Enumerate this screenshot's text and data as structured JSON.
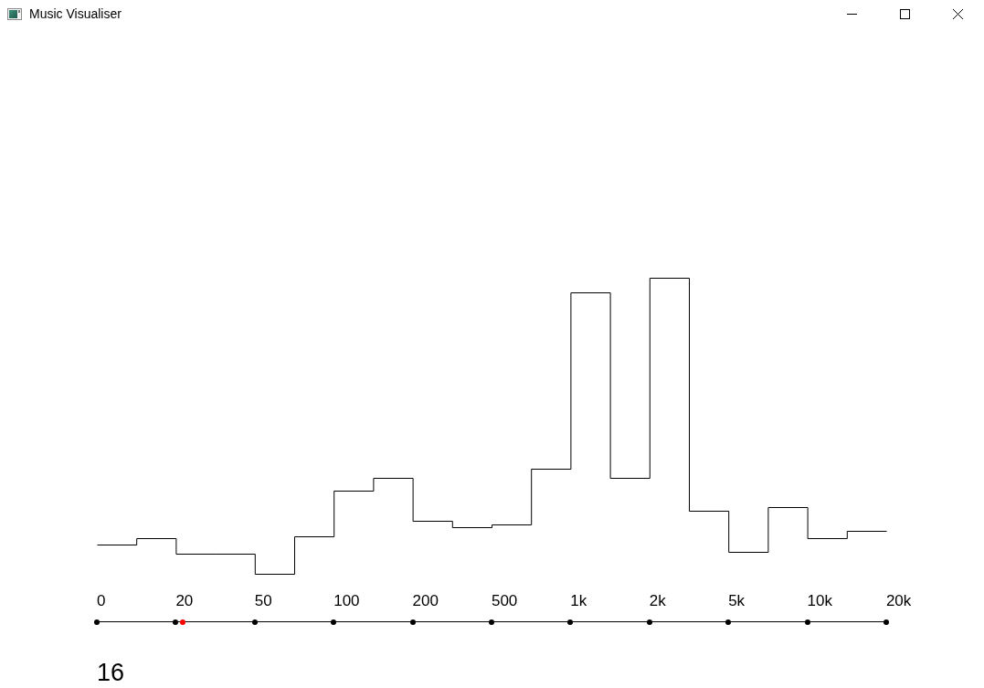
{
  "window": {
    "title": "Music Visualiser"
  },
  "frequency_axis": {
    "labels": [
      "0",
      "20",
      "50",
      "100",
      "200",
      "500",
      "1k",
      "2k",
      "5k",
      "10k",
      "20k"
    ],
    "level": 0.109
  },
  "readout": "16"
}
